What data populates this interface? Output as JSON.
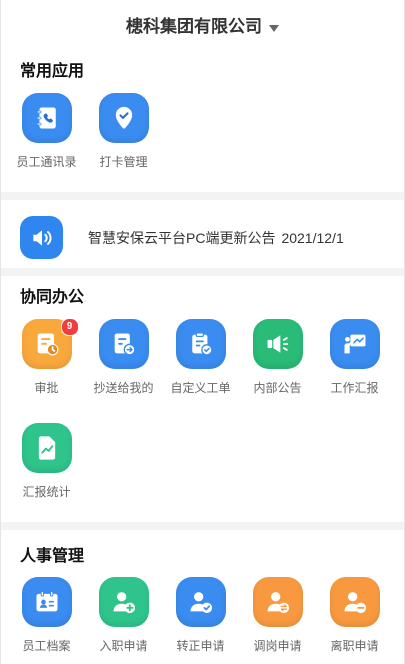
{
  "header": {
    "title": "槵科集团有限公司",
    "dropdown_icon": "caret-down-icon"
  },
  "common_apps": {
    "title": "常用应用",
    "items": [
      {
        "label": "员工通讯录",
        "icon": "address-book-icon",
        "color": "#3a8cf0"
      },
      {
        "label": "打卡管理",
        "icon": "location-pin-icon",
        "color": "#3a8cf0"
      }
    ]
  },
  "announcement": {
    "icon": "speaker-icon",
    "color": "#2f86ee",
    "title": "智慧安保云平台PC端更新公告",
    "date": "2021/12/1"
  },
  "collab_office": {
    "title": "协同办公",
    "items": [
      {
        "label": "审批",
        "icon": "approval-icon",
        "color": "#f9a83c",
        "badge": "9"
      },
      {
        "label": "抄送给我的",
        "icon": "cc-to-me-icon",
        "color": "#3a8cf0"
      },
      {
        "label": "自定义工单",
        "icon": "custom-work-order-icon",
        "color": "#3a8cf0"
      },
      {
        "label": "内部公告",
        "icon": "megaphone-icon",
        "color": "#29bb77"
      },
      {
        "label": "工作汇报",
        "icon": "presentation-icon",
        "color": "#3a8cf0"
      },
      {
        "label": "汇报统计",
        "icon": "report-chart-icon",
        "color": "#2ec48b"
      }
    ]
  },
  "hr_management": {
    "title": "人事管理",
    "items": [
      {
        "label": "员工档案",
        "icon": "employee-card-icon",
        "color": "#3a8cf0"
      },
      {
        "label": "入职申请",
        "icon": "user-add-icon",
        "color": "#2ec48b"
      },
      {
        "label": "转正申请",
        "icon": "user-check-icon",
        "color": "#3a8cf0"
      },
      {
        "label": "调岗申请",
        "icon": "user-transfer-icon",
        "color": "#f8993f"
      },
      {
        "label": "离职申请",
        "icon": "user-remove-icon",
        "color": "#f8993f"
      }
    ]
  },
  "badge_color": "#f23d3d",
  "divider_color": "#f2f3f5"
}
